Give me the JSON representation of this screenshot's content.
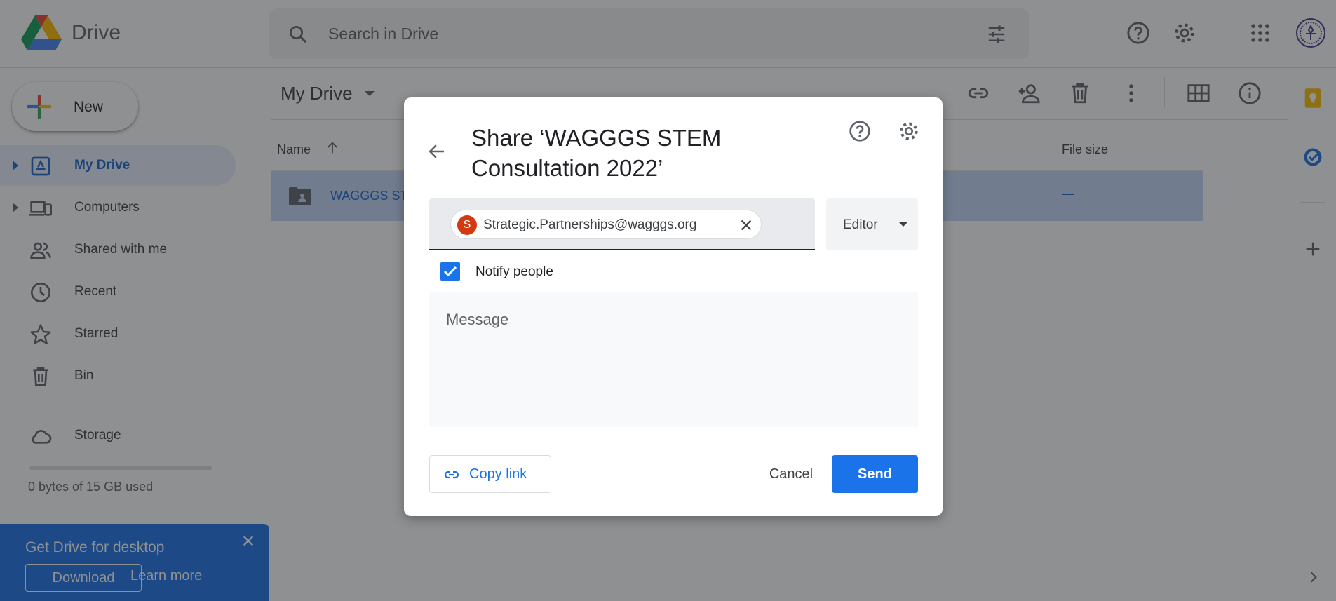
{
  "app": {
    "brand": "Drive"
  },
  "search": {
    "placeholder": "Search in Drive"
  },
  "sidebar": {
    "new_label": "New",
    "items": [
      {
        "label": "My Drive",
        "icon": "my-drive-icon",
        "active": true
      },
      {
        "label": "Computers",
        "icon": "computers-icon"
      },
      {
        "label": "Shared with me",
        "icon": "shared-icon"
      },
      {
        "label": "Recent",
        "icon": "clock-icon"
      },
      {
        "label": "Starred",
        "icon": "star-icon"
      },
      {
        "label": "Bin",
        "icon": "bin-icon"
      }
    ],
    "storage_label": "Storage",
    "storage_used": "0 bytes of 15 GB used"
  },
  "promo": {
    "title": "Get Drive for desktop",
    "download": "Download",
    "learn_more": "Learn more"
  },
  "main": {
    "title": "My Drive",
    "columns": {
      "name": "Name",
      "file_size": "File size"
    },
    "files": [
      {
        "name": "WAGGGS ST",
        "size": "—"
      }
    ]
  },
  "dialog": {
    "title": "Share ‘WAGGGS STEM Consultation 2022’",
    "recipient": {
      "initial": "S",
      "email": "Strategic.Partnerships@wagggs.org"
    },
    "role": "Editor",
    "notify_label": "Notify people",
    "notify_checked": true,
    "message_placeholder": "Message",
    "copy_link": "Copy link",
    "cancel": "Cancel",
    "send": "Send"
  },
  "colors": {
    "accent": "#1a73e8",
    "chip_avatar": "#d33a12",
    "selected_row": "#c2d7fb"
  }
}
